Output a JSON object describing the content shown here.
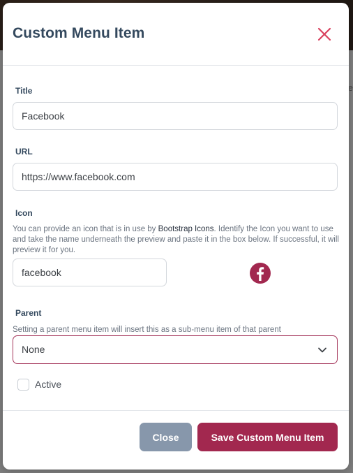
{
  "backdrop": {
    "peek_text": "e"
  },
  "modal": {
    "title": "Custom Menu Item",
    "close_icon": "close-x-icon",
    "accent_color": "#a2284f"
  },
  "form": {
    "title": {
      "label": "Title",
      "value": "Facebook"
    },
    "url": {
      "label": "URL",
      "value": "https://www.facebook.com"
    },
    "icon": {
      "label": "Icon",
      "help_before": "You can provide an icon that is in use by ",
      "help_link": "Bootstrap Icons",
      "help_after": ". Identify the Icon you want to use and take the name underneath the preview and paste it in the box below. If successful, it will preview it for you.",
      "value": "facebook",
      "preview_icon": "facebook-icon"
    },
    "parent": {
      "label": "Parent",
      "help": "Setting a parent menu item will insert this as a sub-menu item of that parent",
      "selected": "None"
    },
    "active": {
      "label": "Active",
      "checked": false
    }
  },
  "footer": {
    "close_label": "Close",
    "save_label": "Save Custom Menu Item"
  }
}
